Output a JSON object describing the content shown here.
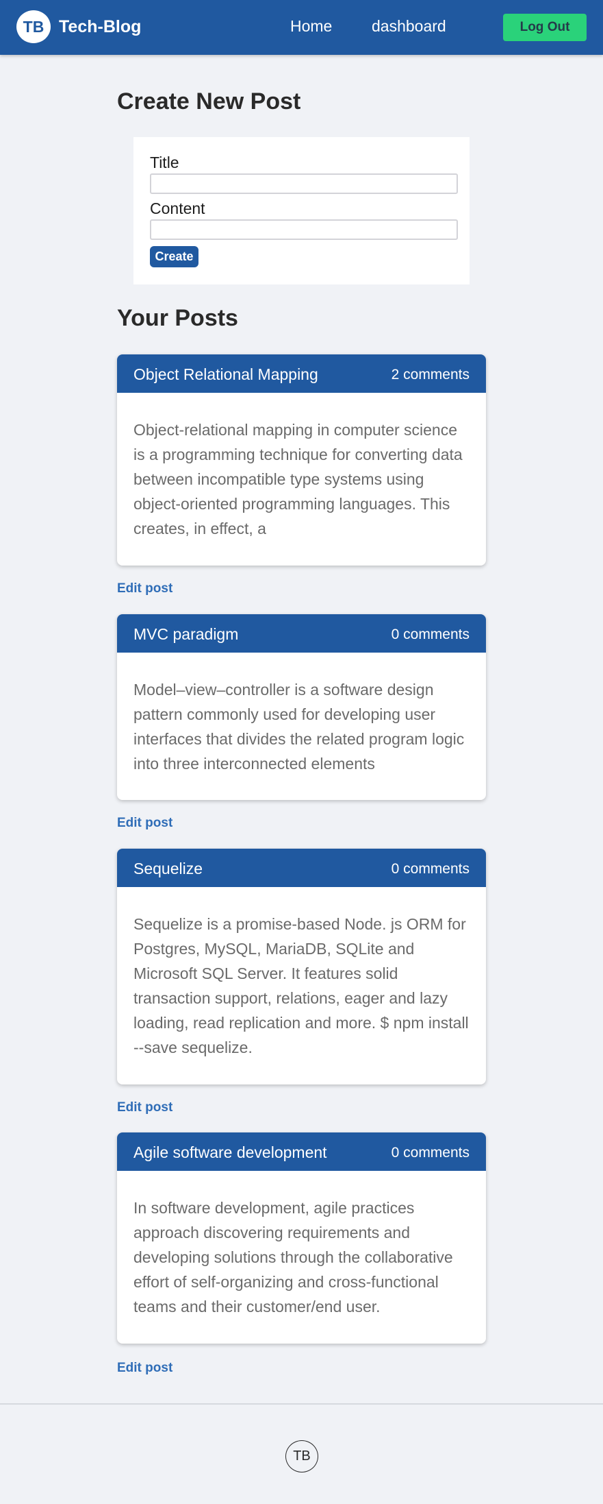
{
  "header": {
    "logo_text": "TB",
    "brand": "Tech-Blog",
    "nav": {
      "home": "Home",
      "dashboard": "dashboard"
    },
    "logout_label": "Log Out"
  },
  "create": {
    "heading": "Create New Post",
    "title_label": "Title",
    "title_value": "",
    "content_label": "Content",
    "content_value": "",
    "submit_label": "Create"
  },
  "posts_heading": "Your Posts",
  "posts": [
    {
      "title": "Object Relational Mapping",
      "comments": "2 comments",
      "body": "Object-relational mapping in computer science is a programming technique for converting data between incompatible type systems using object-oriented programming languages. This creates, in effect, a",
      "edit_label": "Edit post"
    },
    {
      "title": "MVC paradigm",
      "comments": "0 comments",
      "body": "Model–view–controller is a software design pattern commonly used for developing user interfaces that divides the related program logic into three interconnected elements",
      "edit_label": "Edit post"
    },
    {
      "title": "Sequelize",
      "comments": "0 comments",
      "body": "Sequelize is a promise-based Node. js ORM for Postgres, MySQL, MariaDB, SQLite and Microsoft SQL Server. It features solid transaction support, relations, eager and lazy loading, read replication and more. $ npm install --save sequelize.",
      "edit_label": "Edit post"
    },
    {
      "title": "Agile software development",
      "comments": "0 comments",
      "body": "In software development, agile practices approach discovering requirements and developing solutions through the collaborative effort of self-organizing and cross-functional teams and their customer/end user.",
      "edit_label": "Edit post"
    }
  ],
  "footer": {
    "logo_text": "TB"
  },
  "colors": {
    "brand_blue": "#2059a0",
    "logout_green": "#2ad27a",
    "link_blue": "#2f6db7",
    "page_bg": "#f0f2f6"
  }
}
